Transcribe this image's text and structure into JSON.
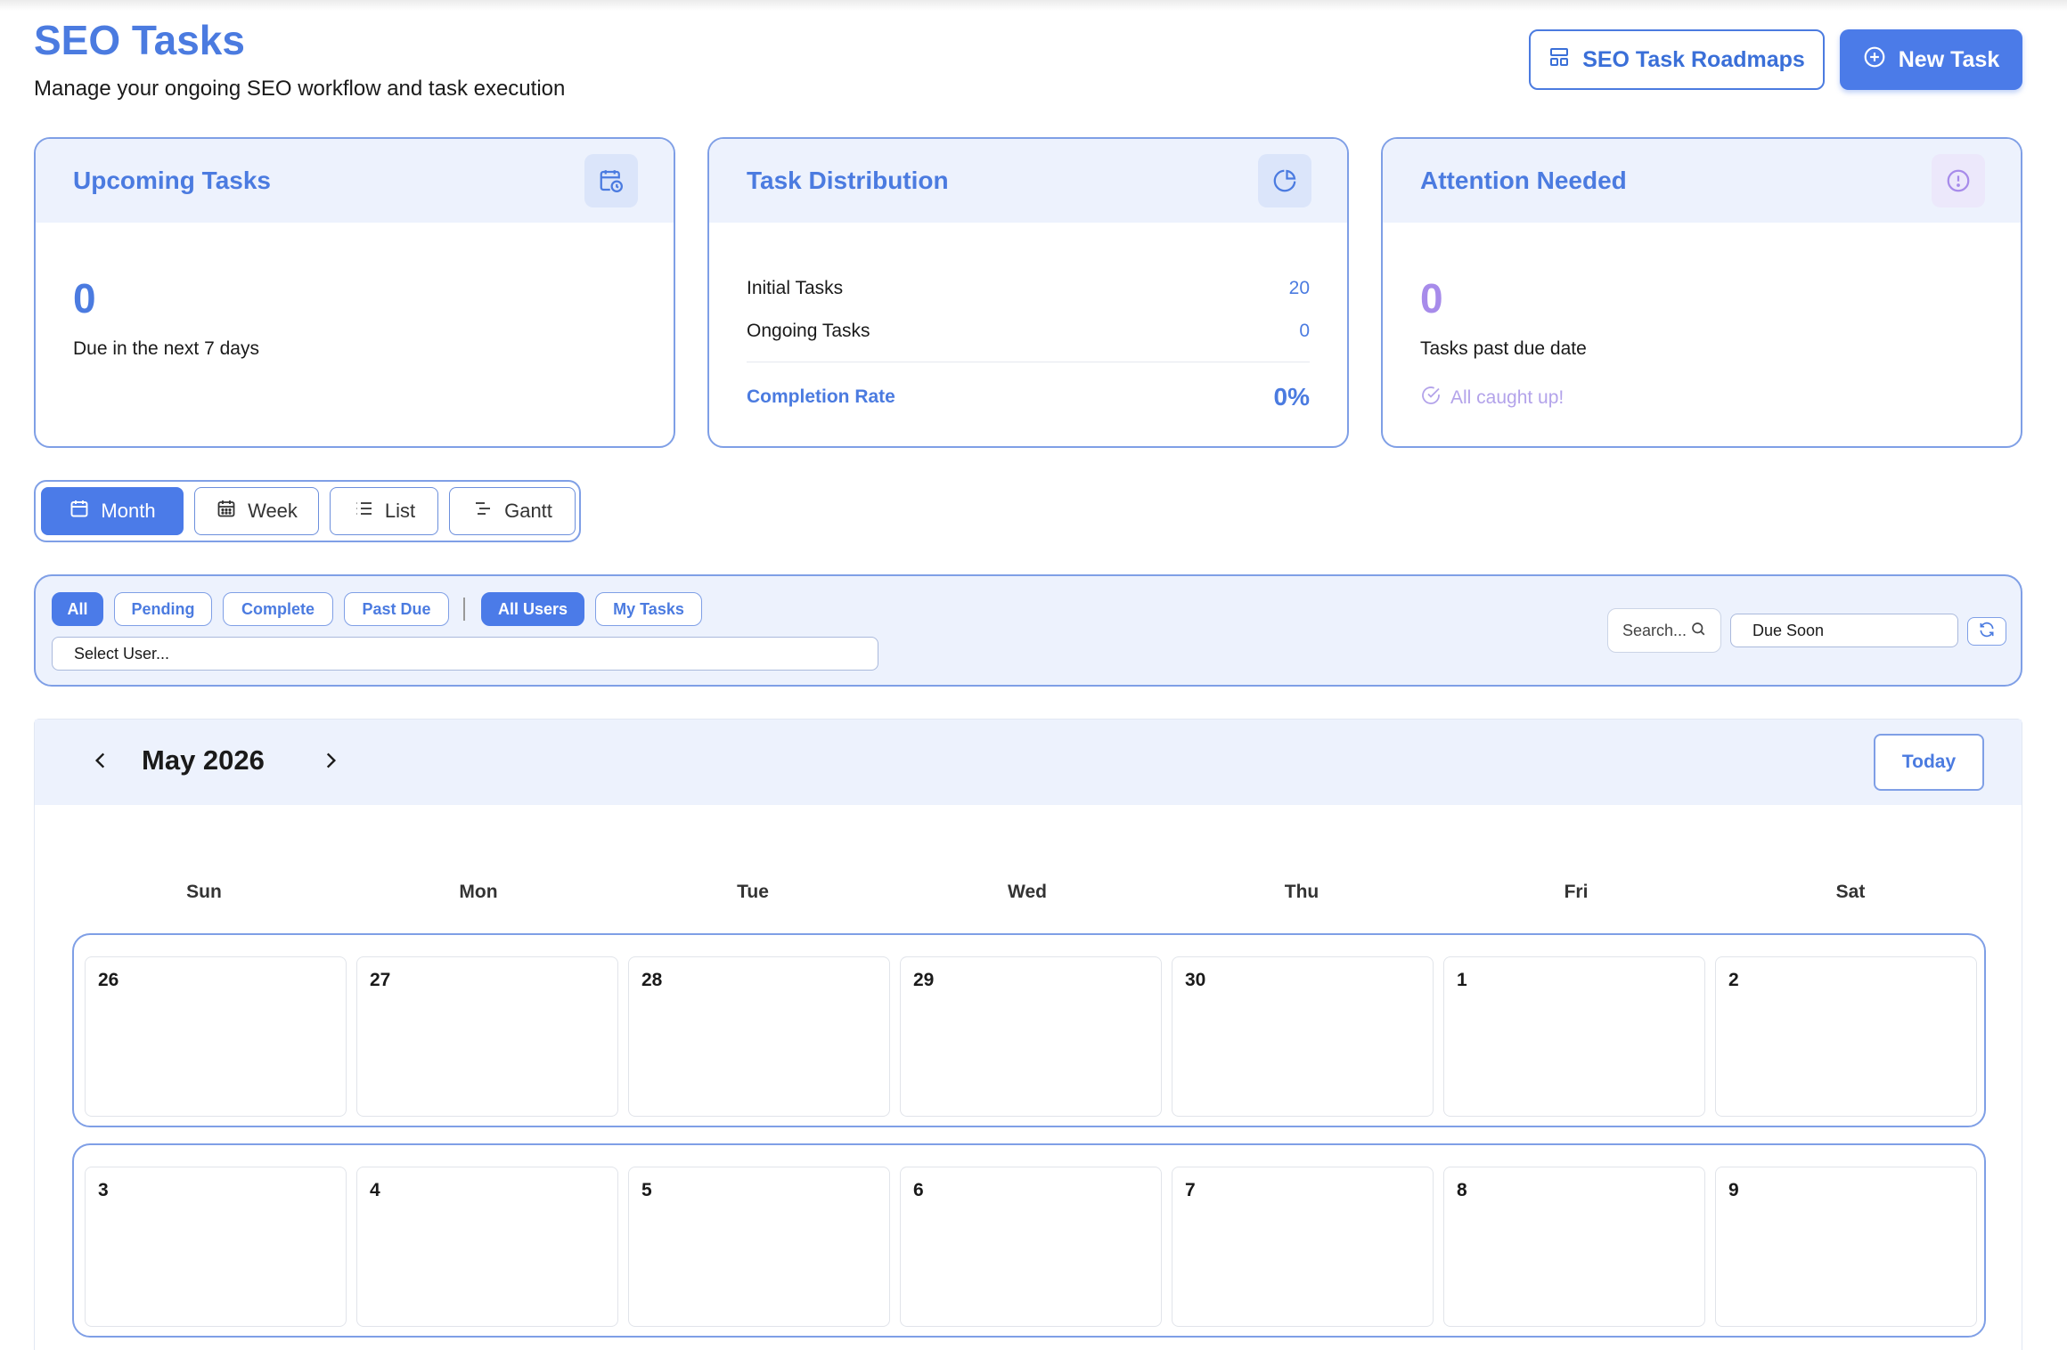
{
  "header": {
    "title": "SEO Tasks",
    "subtitle": "Manage your ongoing SEO workflow and task execution",
    "roadmaps_label": "SEO Task Roadmaps",
    "new_task_label": "New Task"
  },
  "cards": {
    "upcoming": {
      "title": "Upcoming Tasks",
      "value": "0",
      "caption": "Due in the next 7 days",
      "icon": "calendar-clock-icon"
    },
    "distribution": {
      "title": "Task Distribution",
      "icon": "pie-chart-icon",
      "initial_label": "Initial Tasks",
      "initial_value": "20",
      "ongoing_label": "Ongoing Tasks",
      "ongoing_value": "0",
      "completion_label": "Completion Rate",
      "completion_value": "0%"
    },
    "attention": {
      "title": "Attention Needed",
      "value": "0",
      "caption": "Tasks past due date",
      "status": "All caught up!",
      "icon": "alert-circle-icon"
    }
  },
  "views": {
    "month": "Month",
    "week": "Week",
    "list": "List",
    "gantt": "Gantt",
    "active": "Month"
  },
  "filters": {
    "status": {
      "all": "All",
      "pending": "Pending",
      "complete": "Complete",
      "past_due": "Past Due"
    },
    "users": {
      "all_users": "All Users",
      "my_tasks": "My Tasks"
    },
    "select_user": "Select User...",
    "search_placeholder": "Search...",
    "sort_value": "Due Soon"
  },
  "calendar": {
    "month_label": "May 2026",
    "today_label": "Today",
    "weekdays": [
      "Sun",
      "Mon",
      "Tue",
      "Wed",
      "Thu",
      "Fri",
      "Sat"
    ],
    "weeks": [
      [
        "26",
        "27",
        "28",
        "29",
        "30",
        "1",
        "2"
      ],
      [
        "3",
        "4",
        "5",
        "6",
        "7",
        "8",
        "9"
      ]
    ]
  },
  "colors": {
    "accent": "#4b7be8",
    "accent_text": "#4b7be0",
    "panel_bg": "#edf2fd",
    "purple": "#a78bea",
    "muted_purple": "#b3a3ea"
  }
}
